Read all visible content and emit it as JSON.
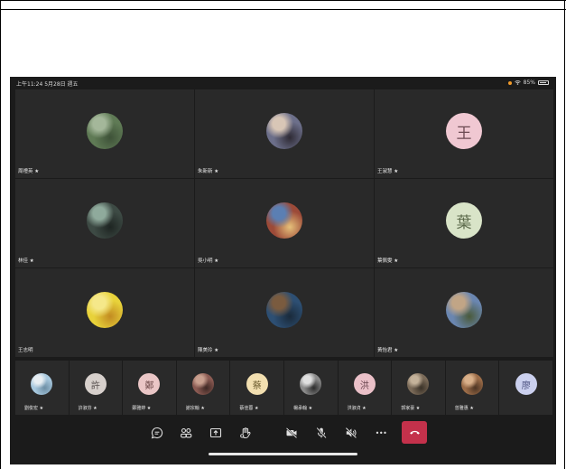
{
  "status_bar": {
    "time_date": "上午11:24  5月28日 週五",
    "battery": "85%"
  },
  "tiles": [
    {
      "name": "周禮英 ★",
      "avatar_type": "photo",
      "colors": [
        "#5f7a55",
        "#a4b79a",
        "#3e5238"
      ]
    },
    {
      "name": "朱新新 ★",
      "avatar_type": "photo",
      "colors": [
        "#6c6f8a",
        "#d8c6b6",
        "#2e2a34"
      ]
    },
    {
      "name": "王淑慧 ★",
      "avatar_type": "initial",
      "initial": "王",
      "bg": "#f0c8d2",
      "fg": "#6b4a52"
    },
    {
      "name": "林佳 ★",
      "avatar_type": "photo",
      "colors": [
        "#3d4a44",
        "#8faa9c",
        "#1e2522"
      ]
    },
    {
      "name": "吳小明 ★",
      "avatar_type": "photo",
      "colors": [
        "#9c4a38",
        "#5b7fb3",
        "#e6c07a"
      ]
    },
    {
      "name": "葉佩雯 ★",
      "avatar_type": "initial",
      "initial": "葉",
      "bg": "#d9e4c8",
      "fg": "#5d6b4c"
    },
    {
      "name": "王志明",
      "avatar_type": "photo",
      "colors": [
        "#e8d23a",
        "#f5e88a",
        "#c28b22"
      ]
    },
    {
      "name": "陳美玲 ★",
      "avatar_type": "photo",
      "colors": [
        "#2d4f73",
        "#7a5b3f",
        "#1a2a3a"
      ]
    },
    {
      "name": "黃怡君 ★",
      "avatar_type": "photo",
      "colors": [
        "#6a86b0",
        "#c1a586",
        "#4a5a3a"
      ]
    }
  ],
  "thumbs": [
    {
      "name": "劉俊宏 ★",
      "avatar_type": "photo",
      "colors": [
        "#a7c8de",
        "#e8eef2",
        "#6d8ea4"
      ]
    },
    {
      "name": "許淑芬 ★",
      "avatar_type": "initial",
      "initial": "許",
      "bg": "#d7d0cc",
      "fg": "#5a5250"
    },
    {
      "name": "鄭雅婷 ★",
      "avatar_type": "initial",
      "initial": "鄭",
      "bg": "#eac6c6",
      "fg": "#6b4646"
    },
    {
      "name": "謝宗翰 ★",
      "avatar_type": "photo",
      "colors": [
        "#8a5a52",
        "#c9a08f",
        "#3e2824"
      ]
    },
    {
      "name": "蔡佳蓉 ★",
      "avatar_type": "initial",
      "initial": "蔡",
      "bg": "#f2dfb0",
      "fg": "#6d5d30"
    },
    {
      "name": "楊承翰 ★",
      "avatar_type": "photo",
      "colors": [
        "#8b8b8b",
        "#e0e0e0",
        "#2c2c2c"
      ]
    },
    {
      "name": "洪淑貞 ★",
      "avatar_type": "initial",
      "initial": "洪",
      "bg": "#eac0c8",
      "fg": "#6b4650"
    },
    {
      "name": "郭家豪 ★",
      "avatar_type": "photo",
      "colors": [
        "#7a6a58",
        "#c4b29a",
        "#3a3228"
      ]
    },
    {
      "name": "曾雅惠 ★",
      "avatar_type": "photo",
      "colors": [
        "#9b6c48",
        "#d9b08a",
        "#4d3524"
      ]
    },
    {
      "name": "",
      "avatar_type": "initial",
      "initial": "廖",
      "bg": "#cbd0ee",
      "fg": "#4c5180"
    }
  ],
  "controls": {
    "icons": [
      "chat-icon",
      "participants-icon",
      "share-screen-icon",
      "raise-hand-icon",
      "camera-off-icon",
      "mic-off-icon",
      "speaker-off-icon",
      "more-options-icon"
    ],
    "more_label": "•••",
    "hangup_color": "#c4314b"
  }
}
